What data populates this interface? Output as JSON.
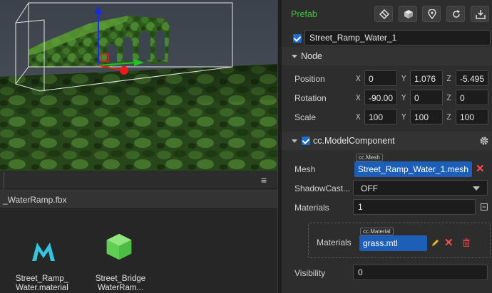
{
  "inspector": {
    "title": "Prefab",
    "node_name": "Street_Ramp_Water_1",
    "node_section": "Node",
    "position": {
      "label": "Position",
      "x": "0",
      "y": "1.076",
      "z": "-5.495"
    },
    "rotation": {
      "label": "Rotation",
      "x": "-90.00",
      "y": "0",
      "z": "0"
    },
    "scale": {
      "label": "Scale",
      "x": "100",
      "y": "100",
      "z": "100"
    },
    "axis_x": "X",
    "axis_y": "Y",
    "axis_z": "Z",
    "component": {
      "title": "cc.ModelComponent",
      "mesh_label": "Mesh",
      "mesh_tag": "cc.Mesh",
      "mesh_value": "Street_Ramp_Water_1.mesh",
      "shadow_label": "ShadowCast...",
      "shadow_value": "OFF",
      "materials_label": "Materials",
      "materials_count": "1",
      "material_item_label": "Materials",
      "material_tag": "cc.Material",
      "material_value": "grass.mtl",
      "visibility_label": "Visibility",
      "visibility_value": "0"
    },
    "colors": {
      "prefab_green": "#41c43d",
      "asset_blue": "#1d5fb7",
      "remove_red": "#ff4d4d"
    }
  },
  "assets": {
    "menu_icon": "≡",
    "path": "_WaterRamp.fbx",
    "items": [
      {
        "line1": "Street_Ramp_",
        "line2": "Water.material",
        "icon": "material-icon"
      },
      {
        "line1": "Street_Bridge",
        "line2": "WaterRam...",
        "icon": "prefab-cube-icon"
      }
    ]
  },
  "scene": {
    "gizmo_colors": {
      "x": "#22c322",
      "y": "#1a2ed6",
      "z": "#e81b1b"
    }
  }
}
